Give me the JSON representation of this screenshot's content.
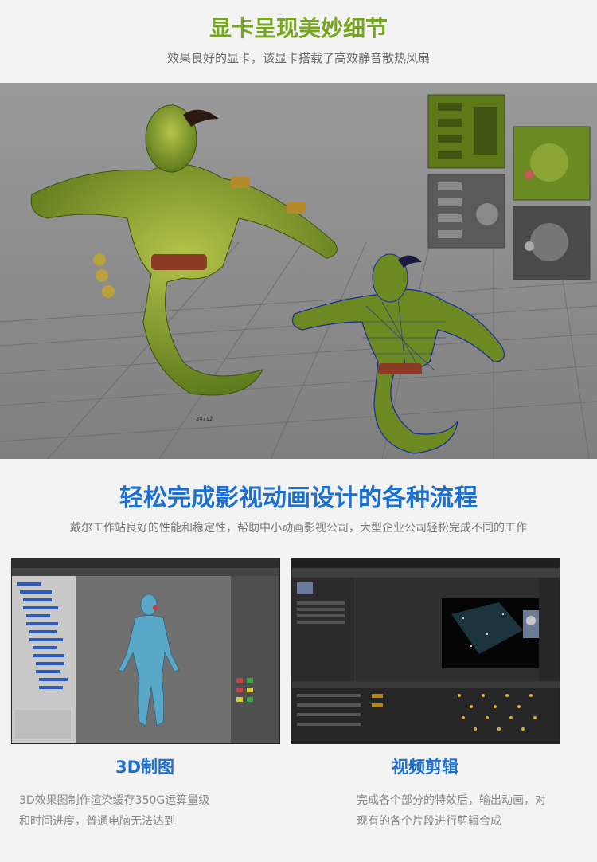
{
  "section1": {
    "title": "显卡呈现美妙细节",
    "subtitle": "效果良好的显卡，该显卡搭载了高效静音散热风扇",
    "viewport_label": "24712"
  },
  "section2": {
    "title": "轻松完成影视动画设计的各种流程",
    "subtitle": "戴尔工作站良好的性能和稳定性，帮助中小动画影视公司，大型企业公司轻松完成不同的工作"
  },
  "features": [
    {
      "caption": "3D制图",
      "line1": "3D效果图制作渲染缓存350G运算量级",
      "line2": "和时间进度，普通电脑无法达到"
    },
    {
      "caption": "视频剪辑",
      "line1": "完成各个部分的特效后，输出动画，对",
      "line2": "现有的各个片段进行剪辑合成"
    }
  ],
  "colors": {
    "title_green": "#76a61c",
    "title_blue": "#1b6fd0"
  }
}
